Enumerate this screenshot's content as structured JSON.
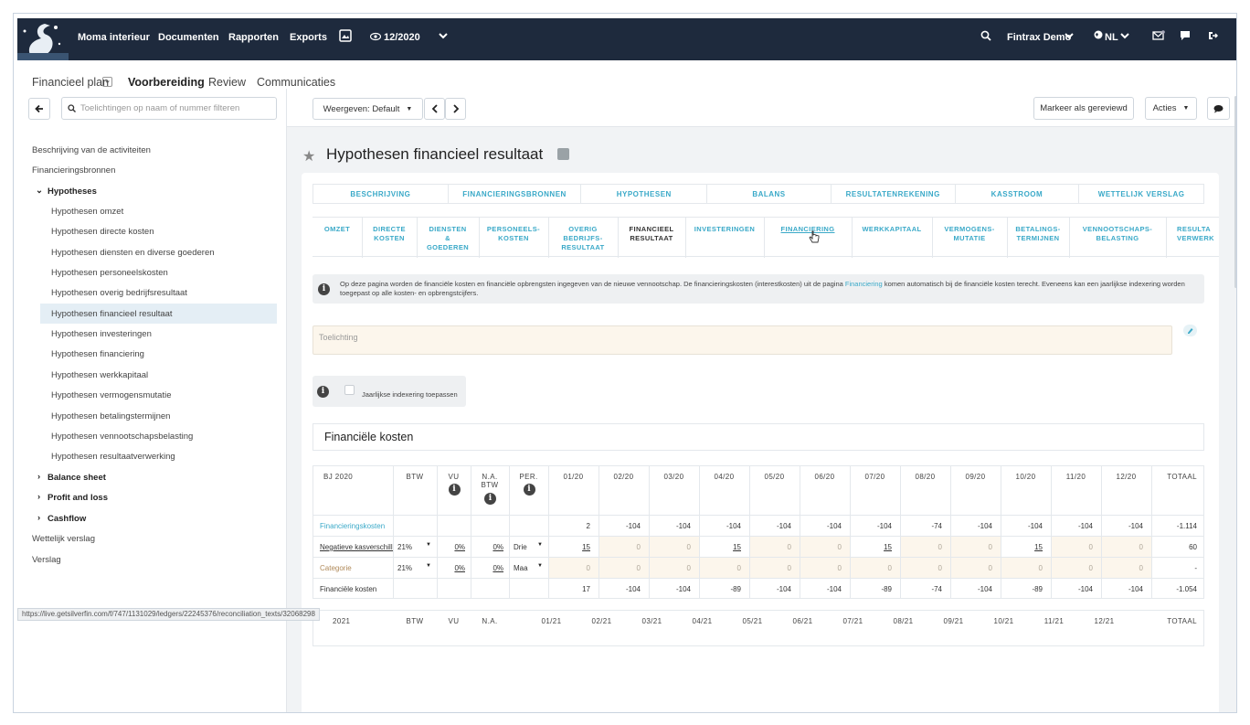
{
  "topbar": {
    "items": [
      "Moma interieur",
      "Documenten",
      "Rapporten",
      "Exports"
    ],
    "period": "12/2020",
    "company": "Fintrax Demo",
    "language": "NL"
  },
  "tabs": [
    "Financieel plan",
    "Voorbereiding",
    "Review",
    "Communicaties"
  ],
  "sidebar": {
    "filter_placeholder": "Toelichtingen op naam of nummer filteren",
    "items": [
      "Beschrijving van de activiteiten",
      "Financieringsbronnen",
      "Hypotheses",
      "Hypothesen omzet",
      "Hypothesen directe kosten",
      "Hypothesen diensten en diverse goederen",
      "Hypothesen personeelskosten",
      "Hypothesen overig bedrijfsresultaat",
      "Hypothesen financieel resultaat",
      "Hypothesen investeringen",
      "Hypothesen financiering",
      "Hypothesen werkkapitaal",
      "Hypothesen vermogensmutatie",
      "Hypothesen betalingstermijnen",
      "Hypothesen vennootschapsbelasting",
      "Hypothesen resultaatverwerking",
      "Balance sheet",
      "Profit and loss",
      "Cashflow",
      "Wettelijk verslag",
      "Verslag"
    ]
  },
  "toolbar": {
    "view": "Weergeven: Default",
    "mark_reviewed": "Markeer als gereviewd",
    "actions": "Acties"
  },
  "page_title": "Hypothesen financieel resultaat",
  "tabrow1": [
    "BESCHRIJVING",
    "FINANCIERINGSBRONNEN",
    "HYPOTHESEN",
    "BALANS",
    "RESULTATENREKENING",
    "KASSTROOM",
    "WETTELIJK VERSLAG"
  ],
  "tabrow2": [
    "OMZET",
    "DIRECTE\nKOSTEN",
    "DIENSTEN\n&\nGOEDEREN",
    "PERSONEELS-\nKOSTEN",
    "OVERIG\nBEDRIJFS-\nRESULTAAT",
    "FINANCIEEL\nRESULTAAT",
    "INVESTERINGEN",
    "FINANCIERING",
    "WERKKAPITAAL",
    "VERMOGENS-\nMUTATIE",
    "BETALINGS-\nTERMIJNEN",
    "VENNOOTSCHAPS-\nBELASTING",
    "RESULTA\nVERWERK"
  ],
  "info_text_1": "Op deze pagina worden de financiële kosten en financiële opbrengsten ingegeven van de nieuwe vennootschap. De financieringskosten (interestkosten) uit de pagina ",
  "info_link": "Financiering",
  "info_text_2": " komen automatisch bij de financiële kosten terecht. Eveneens kan een jaarlijkse indexering worden",
  "info_text_3": "toegepast op alle kosten- en opbrengstcijfers.",
  "toelichting_placeholder": "Toelichting",
  "indexering_label": "Jaarlijkse indexering toepassen",
  "section_title": "Financiële kosten",
  "table2020": {
    "headers": [
      "BJ 2020",
      "BTW",
      "VU",
      "N.A. BTW",
      "PER.",
      "01/20",
      "02/20",
      "03/20",
      "04/20",
      "05/20",
      "06/20",
      "07/20",
      "08/20",
      "09/20",
      "10/20",
      "11/20",
      "12/20",
      "TOTAAL"
    ],
    "rows": [
      {
        "label": "Financieringskosten",
        "btw": "",
        "vu": "",
        "na": "",
        "per": "",
        "values": [
          "2",
          "-104",
          "-104",
          "-104",
          "-104",
          "-104",
          "-104",
          "-74",
          "-104",
          "-104",
          "-104",
          "-104"
        ],
        "total": "-1.114"
      },
      {
        "label": "Negatieve kasverschille",
        "btw": "21%",
        "vu": "0%",
        "na": "0%",
        "per": "Drie",
        "values": [
          "15",
          "0",
          "0",
          "15",
          "0",
          "0",
          "15",
          "0",
          "0",
          "15",
          "0",
          "0"
        ],
        "total": "60"
      },
      {
        "label": "Categorie",
        "btw": "21%",
        "vu": "0%",
        "na": "0%",
        "per": "Maa",
        "values": [
          "0",
          "0",
          "0",
          "0",
          "0",
          "0",
          "0",
          "0",
          "0",
          "0",
          "0",
          "0"
        ],
        "total": "-"
      },
      {
        "label": "Financiële kosten",
        "btw": "",
        "vu": "",
        "na": "",
        "per": "",
        "values": [
          "17",
          "-104",
          "-104",
          "-89",
          "-104",
          "-104",
          "-89",
          "-74",
          "-104",
          "-89",
          "-104",
          "-104"
        ],
        "total": "-1.054"
      }
    ]
  },
  "table2021_headers": [
    "2021",
    "BTW",
    "VU",
    "N.A.",
    "01/21",
    "02/21",
    "03/21",
    "04/21",
    "05/21",
    "06/21",
    "07/21",
    "08/21",
    "09/21",
    "10/21",
    "11/21",
    "12/21",
    "TOTAAL"
  ],
  "status_url": "https://live.getsilverfin.com/f/747/1131029/ledgers/22245376/reconciliation_texts/32068298"
}
